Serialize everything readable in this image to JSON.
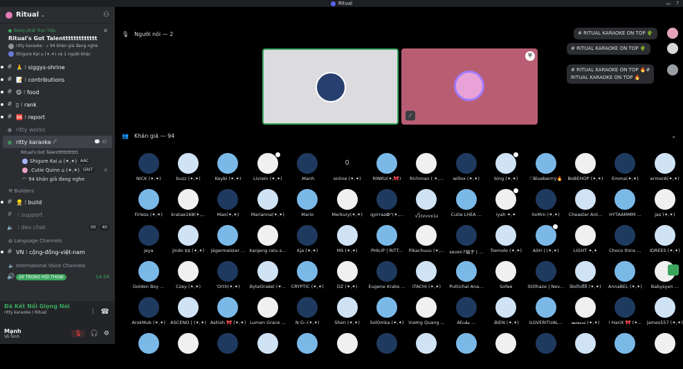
{
  "window": {
    "title": "Ritual"
  },
  "sidebar": {
    "server_name": "Ritual",
    "live": {
      "status": "Đang phát Trực Tiếp",
      "title": "Ritual's Got Talenttttttttttttt",
      "line1": "ritty karaoke · ⌕ 94 khán giả đang nghe",
      "line2": "Shigure Kai ⌂ (✦,✦) và 1 người khác"
    },
    "channels": [
      {
        "name": "siggys-shrine",
        "emoji": "🙏",
        "unread": true
      },
      {
        "name": "contributions",
        "emoji": "📝",
        "unread": true
      },
      {
        "name": "food",
        "emoji": "😋",
        "unread": true
      },
      {
        "name": "rank",
        "emoji": "▯",
        "unread": true
      },
      {
        "name": "report",
        "emoji": "🆘",
        "unread": true
      }
    ],
    "voice_channel_1": "ritty works",
    "voice_active": {
      "name": "ritty karaoke",
      "subtitle": "Ritual's Got Talenttttttttttttt"
    },
    "voice_users": [
      {
        "name": "Shigure Kai ⌂ (✦,✦)",
        "tag": "AAC"
      },
      {
        "name": ".Cutie Quinn ⌂ (✦,✦)",
        "tag": "GRIT"
      }
    ],
    "audience_line": "94 khán giả đang nghe",
    "cat_builders": "Builders",
    "builders": [
      {
        "name": "build",
        "emoji": "👷"
      },
      {
        "name": "support",
        "emoji": ""
      },
      {
        "name": "dev chat",
        "emoji": "",
        "badges": [
          "00",
          "40"
        ]
      }
    ],
    "cat_language": "Language Channels",
    "language": [
      {
        "name": "VN ⁝ cộng-đồng-việt-nam"
      }
    ],
    "cat_intl": "International Voice Channels",
    "intl_line": "26 TRONG HỘI THOẠI",
    "intl_time": "14:24",
    "voice_bar": {
      "title": "Đã Kết Nối Giọng Nói",
      "sub": "ritty karaoke / Ritual"
    },
    "user": {
      "name": "Mạnh",
      "status": "Vô hình"
    }
  },
  "stage": {
    "speakers_label": "Người nói — 2",
    "audience_label": "Khán giả — 94",
    "chat": [
      "# RITUAL KARAOKE ON TOP 🌵",
      "# RITUAL KARAOKE ON TOP 🌵",
      "# RITUAL KARAOKE ON TOP 🔥#",
      "RITUAL KARAOKE ON TOP 🔥"
    ]
  },
  "audience": [
    "NICK (✦,✦)",
    "buzz (✦,✦)",
    "Keybi (✦,✦)",
    "Livrein (✦,✦)",
    ".Manh",
    "online (✦,✦)",
    "RINKU(✦,🎀)",
    "Richman ( ✦,...",
    "willox (✦,✦)",
    "bing (✦,✦)",
    "♡Blueberrry🔥",
    "BoBEHOP (✦,✦)",
    "Emma(✦,✦)",
    "ermorA(✦,✦)",
    "Firless (✦,✦)",
    "kratae168(✦,...",
    "Mao(✦,✦)",
    "Marianna(✦,✦)",
    "Mario",
    "Merkury(✦,✦)",
    "qyirraa✿°(✦,...",
    "ꪜ1tvvvx1ε",
    "Cutie LHEA ...",
    "iyah ✦,✦",
    "0xMrn (✦,✦)",
    "Cheaster Ant...",
    "HYTAAMMM ...",
    "jas (✦,✦)",
    "jeya",
    "jindo $$ (✦,✦)",
    "Jägermeister ...",
    "kanjeng ratu s...",
    "Kja (✦,✦)",
    "MS (✦,✦)",
    "PHILIP | RITT...",
    "Pikachuuu (✦,...",
    "seven7福子 | ...",
    "Tremolo (✦,✦)",
    "ASH | (✦,✦)",
    "LIGHT ✦,✦",
    "Choco thins ...",
    "IDREES (✦,✦)",
    "Golden Boy ...",
    "Czey (✦,✦)",
    "'Orth(✦,✦)",
    "ByteOrakel (✦...",
    "CRYPTIC (✦,✦)",
    "DZ (✦,✦)",
    "Eugene Krabs ...",
    "ITACHI (✦,✦)",
    "Puttichai Ana...",
    "Sofee",
    "Stillhaze | Nev...",
    "ᗯolfoᘔᘔ (✦,✦)",
    "AnnaBEL (✦,✦)",
    "Babysyen ...",
    "ArokMub (✦,✦)",
    "ASCENO | (✦,✦)",
    "Ashish 🎀 (✦,✦)",
    "Lumen Grace ...",
    "N G--(✦,✦)",
    "Shen (✦,✦)",
    "SolOmka (✦,✦)",
    "Vương Quang ...",
    "Aℓ𝒾𝓈𝒽𝒶 ...",
    ".BIEN (✦,✦)",
    "ILOVERITUAL...",
    "𝓶𝓲𝓷𝓸𝓻𝓲 (✦,✦)",
    "! HariX 🎀 (✦...",
    "james557 (✦,✦)",
    "",
    "",
    "",
    "",
    "",
    "",
    "",
    "",
    "",
    "",
    "",
    "",
    "",
    ""
  ],
  "colors": {
    "accent_green": "#3ba55d",
    "sidebar_bg": "#2b2d31",
    "danger": "#f23f42"
  }
}
